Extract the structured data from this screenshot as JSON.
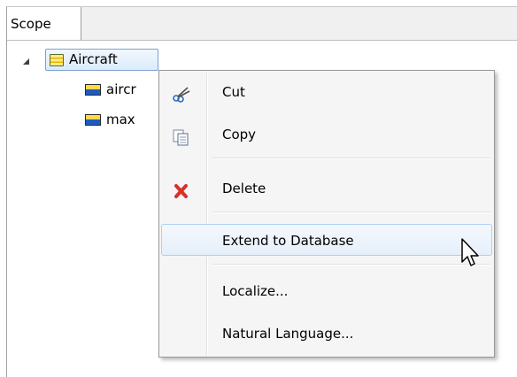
{
  "panel": {
    "tab_label": "Scope"
  },
  "tree": {
    "root": {
      "label": "Aircraft",
      "icon": "entity-icon",
      "expanded": true
    },
    "children": [
      {
        "label": "aircr",
        "icon": "attribute-icon"
      },
      {
        "label": "max",
        "icon": "attribute-icon"
      }
    ]
  },
  "context_menu": {
    "items": [
      {
        "label": "Cut",
        "icon": "scissors-icon"
      },
      {
        "label": "Copy",
        "icon": "copy-icon"
      },
      {
        "label": "Delete",
        "icon": "delete-icon"
      },
      {
        "label": "Extend to Database",
        "icon": "",
        "hovered": true
      },
      {
        "label": "Localize...",
        "icon": ""
      },
      {
        "label": "Natural Language...",
        "icon": ""
      }
    ]
  },
  "colors": {
    "selection_border": "#7da2ce",
    "hover_border": "#aecff7",
    "delete_red": "#d9302a",
    "attr_yellow": "#ffd94a",
    "attr_blue": "#1e5bbf"
  }
}
